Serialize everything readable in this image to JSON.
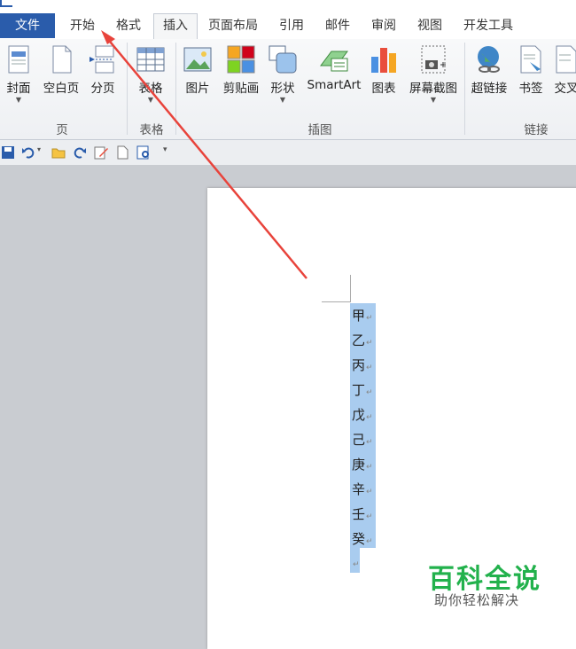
{
  "tabs": [
    {
      "label": "文件"
    },
    {
      "label": "开始"
    },
    {
      "label": "格式"
    },
    {
      "label": "插入"
    },
    {
      "label": "页面布局"
    },
    {
      "label": "引用"
    },
    {
      "label": "邮件"
    },
    {
      "label": "审阅"
    },
    {
      "label": "视图"
    },
    {
      "label": "开发工具"
    }
  ],
  "ribbon": {
    "buttons": [
      {
        "label": "封面",
        "icon": "cover-page-icon"
      },
      {
        "label": "空白页",
        "icon": "blank-page-icon"
      },
      {
        "label": "分页",
        "icon": "page-break-icon"
      },
      {
        "label": "表格",
        "icon": "table-icon"
      },
      {
        "label": "图片",
        "icon": "picture-icon"
      },
      {
        "label": "剪贴画",
        "icon": "clip-art-icon"
      },
      {
        "label": "形状",
        "icon": "shapes-icon"
      },
      {
        "label": "SmartArt",
        "icon": "smartart-icon"
      },
      {
        "label": "图表",
        "icon": "chart-icon"
      },
      {
        "label": "屏幕截图",
        "icon": "screenshot-icon"
      },
      {
        "label": "超链接",
        "icon": "hyperlink-icon"
      },
      {
        "label": "书签",
        "icon": "bookmark-icon"
      },
      {
        "label": "交叉",
        "icon": "cross-reference-icon"
      }
    ],
    "groups": [
      {
        "label": "页"
      },
      {
        "label": "表格"
      },
      {
        "label": "插图"
      },
      {
        "label": "链接"
      }
    ]
  },
  "document": {
    "lines": [
      "甲",
      "乙",
      "丙",
      "丁",
      "戊",
      "己",
      "庚",
      "辛",
      "壬",
      "癸"
    ],
    "paragraph_mark": "↵"
  },
  "watermark": {
    "title": "百科全说",
    "subtitle": "助你轻松解决"
  },
  "colors": {
    "file_tab": "#2a5cab",
    "selection": "#a9ccef",
    "annotation_arrow": "#e8433b",
    "watermark": "#22b14c"
  }
}
